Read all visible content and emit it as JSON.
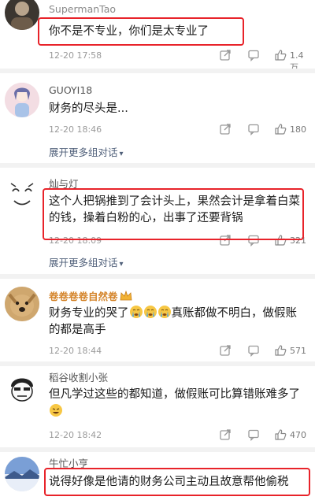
{
  "comments": [
    {
      "username": "SupermanTao",
      "text": "你不是不专业，你们是太专业了",
      "time": "12-20 17:58",
      "likes": "1.4万",
      "avatar_icon": "user-avatar-dark"
    },
    {
      "username": "GUOYI18",
      "text": "财务的尽头是...",
      "time": "12-20 18:46",
      "likes": "180",
      "more": "展开更多组对话",
      "avatar_icon": "user-avatar-anime"
    },
    {
      "username": "灿与灯",
      "text": "这个人把锅推到了会计头上，果然会计是拿着白菜的钱，操着白粉的心，出事了还要背锅",
      "time": "12-20 18:09",
      "likes": "321",
      "more": "展开更多组对话",
      "avatar_icon": "user-avatar-sketch"
    },
    {
      "username": "卷卷卷卷自然卷",
      "text_before": "财务专业的哭了",
      "text_after": "真账都做不明白，做假账的都是高手",
      "time": "12-20 18:44",
      "likes": "571",
      "avatar_icon": "user-avatar-dog"
    },
    {
      "username": "稻谷收割小张",
      "text": "但凡学过这些的都知道，做假账可比算错账难多了",
      "time": "12-20 18:42",
      "likes": "470",
      "avatar_icon": "user-avatar-cartoon"
    },
    {
      "username": "牛忙小亨",
      "text": "说得好像是他请的财务公司主动且故意帮他偷税",
      "avatar_icon": "user-avatar-landscape"
    }
  ],
  "colors": {
    "highlight": "#e8232a",
    "vip_name": "#d4842a",
    "link": "#50607a"
  },
  "icons": {
    "share": "share-icon",
    "reply": "reply-icon",
    "like": "thumbs-up-icon",
    "more": "chevron-down-icon",
    "emoji": "crying-face-emoji",
    "grin": "grin-emoji",
    "crown": "crown-icon"
  }
}
